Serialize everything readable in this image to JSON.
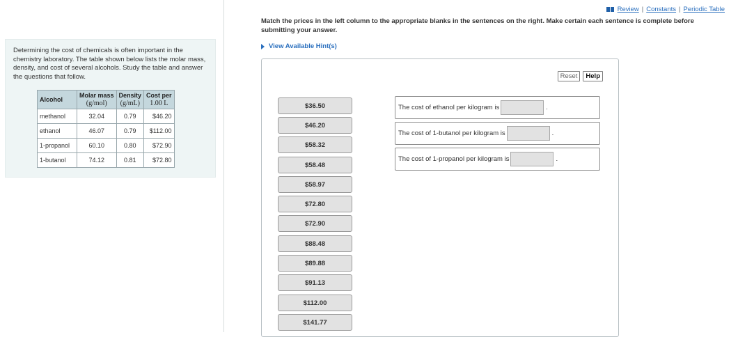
{
  "left": {
    "intro": "Determining the cost of chemicals is often important in the chemistry laboratory. The table shown below lists the molar mass, density, and cost of several alcohols. Study the table and answer the questions that follow.",
    "table": {
      "headers": {
        "alcohol": "Alcohol",
        "molar_mass": "Molar mass",
        "molar_mass_unit": "(g/mol)",
        "density": "Density",
        "density_unit": "(g/mL)",
        "cost": "Cost per",
        "cost_unit": "1.00 L"
      },
      "rows": [
        {
          "alcohol": "methanol",
          "molar_mass": "32.04",
          "density": "0.79",
          "cost": "$46.20"
        },
        {
          "alcohol": "ethanol",
          "molar_mass": "46.07",
          "density": "0.79",
          "cost": "$112.00"
        },
        {
          "alcohol": "1-propanol",
          "molar_mass": "60.10",
          "density": "0.80",
          "cost": "$72.90"
        },
        {
          "alcohol": "1-butanol",
          "molar_mass": "74.12",
          "density": "0.81",
          "cost": "$72.80"
        }
      ]
    }
  },
  "toplinks": {
    "review": "Review",
    "constants": "Constants",
    "periodic": "Periodic Table",
    "sep": "|"
  },
  "instructions": "Match the prices in the left column to the appropriate blanks in the sentences on the right. Make certain each sentence is complete before submitting your answer.",
  "hint": "View Available Hint(s)",
  "buttons": {
    "reset": "Reset",
    "help": "Help"
  },
  "prices": [
    "$36.50",
    "$46.20",
    "$58.32",
    "$58.48",
    "$58.97",
    "$72.80",
    "$72.90",
    "$88.48",
    "$89.88",
    "$91.13",
    "$112.00",
    "$141.77"
  ],
  "sentences": [
    "The cost of ethanol per kilogram is",
    "The cost of 1-butanol per kilogram is",
    "The cost of 1-propanol per kilogram is"
  ],
  "period": "."
}
